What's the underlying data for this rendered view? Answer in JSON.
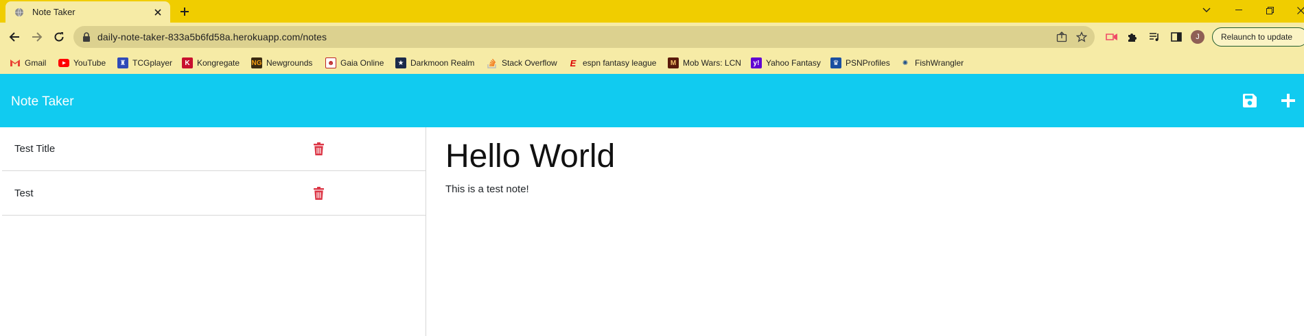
{
  "browser": {
    "tab_title": "Note Taker",
    "url": "daily-note-taker-833a5b6fd58a.herokuapp.com/notes",
    "relaunch_label": "Relaunch to update",
    "profile_initial": "J",
    "bookmarks": [
      {
        "label": "Gmail",
        "icon": "gmail-icon"
      },
      {
        "label": "YouTube",
        "icon": "youtube-icon"
      },
      {
        "label": "TCGplayer",
        "icon": "tcgplayer-icon"
      },
      {
        "label": "Kongregate",
        "icon": "kongregate-icon"
      },
      {
        "label": "Newgrounds",
        "icon": "newgrounds-icon"
      },
      {
        "label": "Gaia Online",
        "icon": "gaia-icon"
      },
      {
        "label": "Darkmoon Realm",
        "icon": "darkmoon-icon"
      },
      {
        "label": "Stack Overflow",
        "icon": "stackoverflow-icon"
      },
      {
        "label": "espn fantasy league",
        "icon": "espn-icon"
      },
      {
        "label": "Mob Wars: LCN",
        "icon": "mobwars-icon"
      },
      {
        "label": "Yahoo Fantasy",
        "icon": "yahoo-icon"
      },
      {
        "label": "PSNProfiles",
        "icon": "psn-icon"
      },
      {
        "label": "FishWrangler",
        "icon": "fishwrangler-icon"
      }
    ]
  },
  "app": {
    "title": "Note Taker",
    "notes": [
      {
        "title": "Test Title"
      },
      {
        "title": "Test"
      }
    ],
    "active_note": {
      "title": "Hello World",
      "text": "This is a test note!"
    }
  },
  "colors": {
    "header": "#11cbf0",
    "trash": "#dc3545",
    "tabstrip": "#f0cd00",
    "toolbar": "#f6eba6"
  }
}
